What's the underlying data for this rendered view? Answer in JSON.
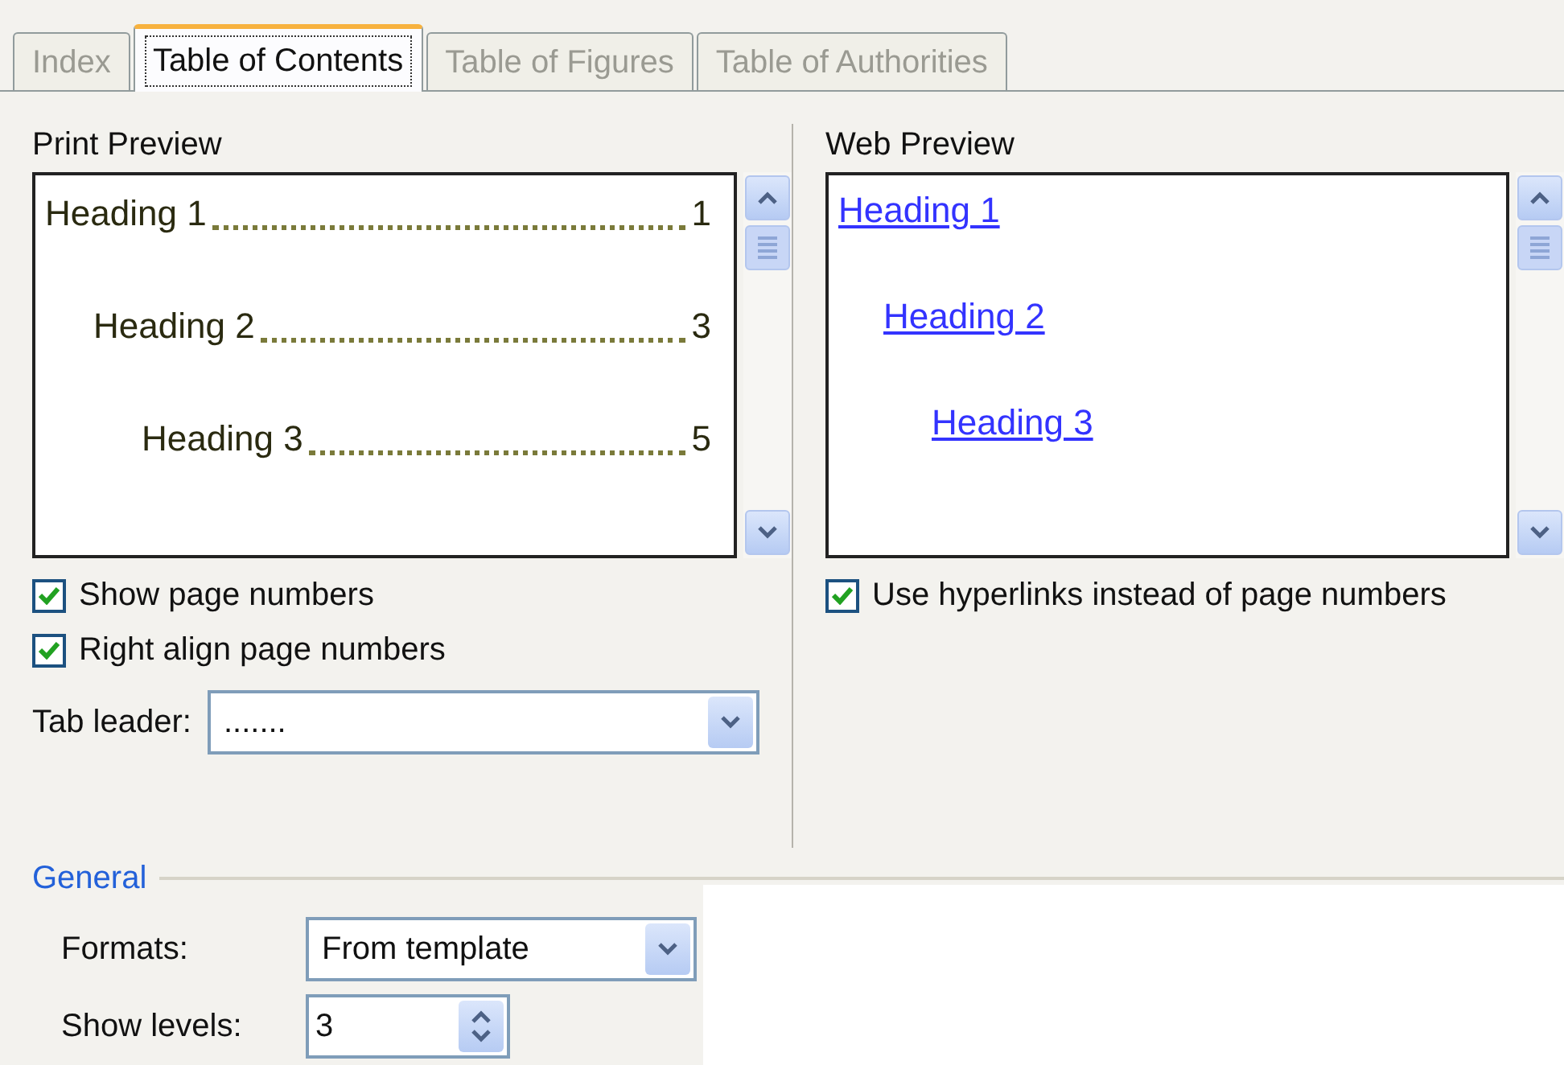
{
  "tabs": [
    {
      "label": "Index",
      "selected": false
    },
    {
      "label": "Table of Contents",
      "selected": true
    },
    {
      "label": "Table of Figures",
      "selected": false
    },
    {
      "label": "Table of Authorities",
      "selected": false
    }
  ],
  "print_preview": {
    "label": "Print Preview",
    "entries": [
      {
        "text": "Heading 1",
        "page": "1",
        "children": [
          {
            "text": "Heading 2",
            "page": "3",
            "children": [
              {
                "text": "Heading 3",
                "page": "5"
              }
            ]
          }
        ]
      }
    ]
  },
  "web_preview": {
    "label": "Web Preview",
    "entries": [
      {
        "text": "Heading 1",
        "children": [
          {
            "text": "Heading 2",
            "children": [
              {
                "text": "Heading 3"
              }
            ]
          }
        ]
      }
    ]
  },
  "print_options": [
    {
      "label": "Show page numbers",
      "checked": true
    },
    {
      "label": "Right align page numbers",
      "checked": true
    }
  ],
  "web_options": [
    {
      "label": "Use hyperlinks instead of page numbers",
      "checked": true
    }
  ],
  "tab_leader": {
    "label": "Tab leader:",
    "value": "......."
  },
  "general": {
    "title": "General",
    "formats": {
      "label": "Formats:",
      "value": "From template"
    },
    "show_levels": {
      "label": "Show levels:",
      "value": "3"
    }
  }
}
